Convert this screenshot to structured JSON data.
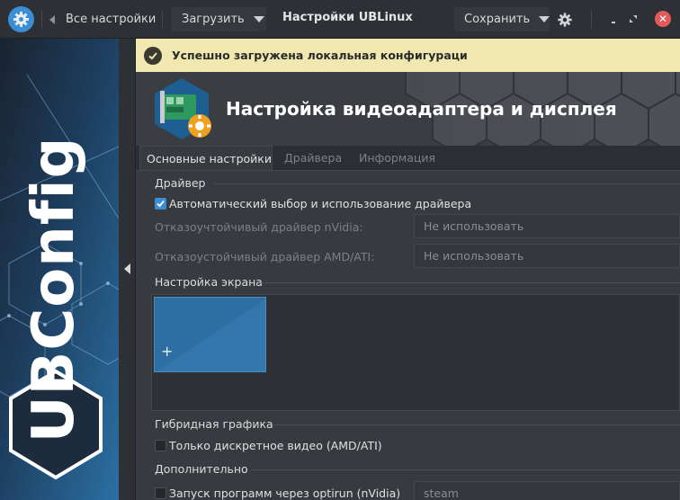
{
  "header": {
    "back_label": "Все настройки",
    "load_label": "Загрузить",
    "title": "Настройки UBLinux",
    "save_label": "Сохранить"
  },
  "sidebar": {
    "brand_text": "UBConfig"
  },
  "notification": {
    "text": "Успешно загружена локальная конфигураци"
  },
  "banner": {
    "title": "Настройка видеоадаптера и дисплея"
  },
  "tabs": [
    {
      "label": "Основные настройки",
      "active": true
    },
    {
      "label": "Драйвера",
      "active": false
    },
    {
      "label": "Информация",
      "active": false
    }
  ],
  "driver": {
    "section_label": "Драйвер",
    "auto_checkbox_label": "Автоматический выбор и использование драйвера",
    "auto_checked": true,
    "nvidia_label": "Отказоучтойчивый драйвер nVidia:",
    "nvidia_value": "Не использовать",
    "amd_label": "Отказоустойчивый драйвер AMD/ATI:",
    "amd_value": "Не использовать"
  },
  "screen": {
    "section_label": "Настройка экрана",
    "add_symbol": "+"
  },
  "hybrid": {
    "section_label": "Гибридная графика",
    "discrete_label": "Только дискретное видео (AMD/ATI)",
    "discrete_checked": false
  },
  "extra": {
    "section_label": "Дополнительно",
    "optirun_label": "Запуск программ через optirun (nVidia)",
    "optirun_value": "steam"
  },
  "colors": {
    "accent": "#3b8ed4",
    "notification_bg": "#f0e7b1",
    "close_button": "#e35a5a"
  }
}
